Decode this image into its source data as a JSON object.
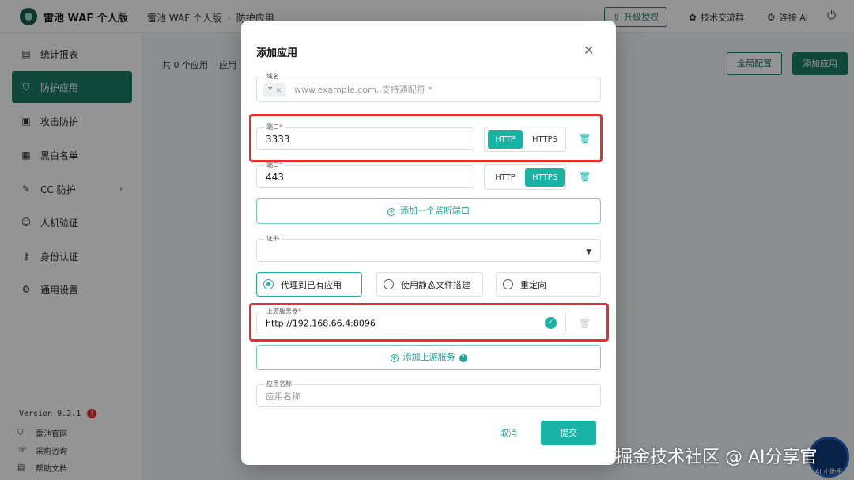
{
  "topbar": {
    "brand": "雷池 WAF 个人版",
    "breadcrumb": [
      "雷池 WAF 个人版",
      "防护应用"
    ],
    "upgrade_label": "升级授权",
    "community_label": "技术交流群",
    "ai_label": "连接 AI"
  },
  "sidebar": {
    "items": [
      {
        "label": "统计报表",
        "icon": "chart-icon"
      },
      {
        "label": "防护应用",
        "icon": "shield-icon",
        "active": true
      },
      {
        "label": "攻击防护",
        "icon": "attack-icon"
      },
      {
        "label": "黑白名单",
        "icon": "list-icon"
      },
      {
        "label": "CC 防护",
        "icon": "cc-icon"
      },
      {
        "label": "人机验证",
        "icon": "robot-icon"
      },
      {
        "label": "身份认证",
        "icon": "key-icon"
      },
      {
        "label": "通用设置",
        "icon": "gear-icon"
      }
    ],
    "version": "Version 9.2.1",
    "version_badge": "!",
    "footer": [
      "雷池官网",
      "采购咨询",
      "帮助文档"
    ]
  },
  "main": {
    "count_text": "共 0 个应用",
    "tab_fragment": "应用",
    "global_config_label": "全局配置",
    "add_app_label": "添加应用",
    "ai_helper_label": "AI 小助手"
  },
  "modal": {
    "title": "添加应用",
    "domain": {
      "label": "域名",
      "chip": "*",
      "placeholder": "www.example.com, 支持通配符 *"
    },
    "ports": [
      {
        "label": "端口",
        "value": "3333",
        "protocols": [
          "HTTP",
          "HTTPS"
        ],
        "selected": "HTTP"
      },
      {
        "label": "端口",
        "value": "443",
        "protocols": [
          "HTTP",
          "HTTPS"
        ],
        "selected": "HTTPS"
      }
    ],
    "add_port_label": "添加一个监听端口",
    "cert": {
      "label": "证书",
      "value": ""
    },
    "modes": {
      "options": [
        "代理到已有应用",
        "使用静态文件搭建",
        "重定向"
      ],
      "selected": "代理到已有应用"
    },
    "upstream": {
      "label": "上游服务器",
      "value": "http://192.168.66.4:8096"
    },
    "add_upstream_label": "添加上游服务",
    "app_name": {
      "label": "应用名称",
      "placeholder": "应用名称"
    },
    "cancel_label": "取消",
    "submit_label": "提交"
  },
  "colors": {
    "accent": "#17b3a5",
    "brand_dark": "#1d7a67",
    "highlight": "#ec2d2d"
  },
  "watermark": "掘金技术社区 @ AI分享官"
}
